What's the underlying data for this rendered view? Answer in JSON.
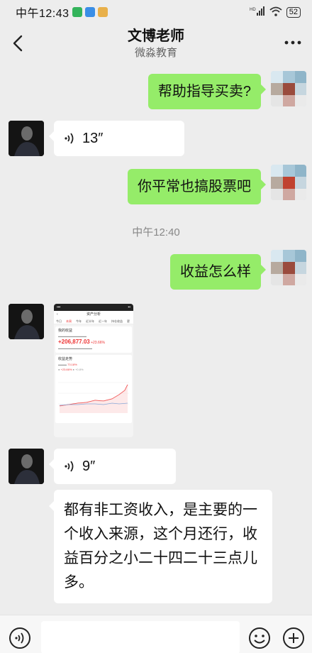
{
  "status_bar": {
    "time": "中午12:43",
    "battery": "52",
    "network": "HD"
  },
  "header": {
    "title": "文博老师",
    "subtitle": "微淼教育"
  },
  "messages": [
    {
      "text": "帮助指导买卖?"
    },
    {
      "duration": "13″"
    },
    {
      "text": "你平常也搞股票吧"
    },
    {
      "text": "收益怎么样"
    },
    {
      "duration": "9″"
    },
    {
      "text": "都有非工资收入，是主要的一个收入来源，这个月还行，收益百分之小二十四二十三点儿多。"
    }
  ],
  "timestamp": "中午12:40",
  "screenshot": {
    "title": "资产分析",
    "tabs": [
      "今日",
      "本周",
      "今年",
      "近半年",
      "近一年",
      "持仓收益",
      "更"
    ],
    "income_label": "我的收益",
    "income_value": "+206,877.03",
    "income_rate": "+23.66%",
    "trend_label": "收益走势",
    "trend_rate": "73.18%",
    "mine_rate": "+23.66%",
    "index_rate": "+0.8%"
  },
  "colors": {
    "mine_bubble": "#95ec69",
    "theirs_bubble": "#ffffff",
    "background": "#ededed",
    "accent_red": "#e33333"
  }
}
